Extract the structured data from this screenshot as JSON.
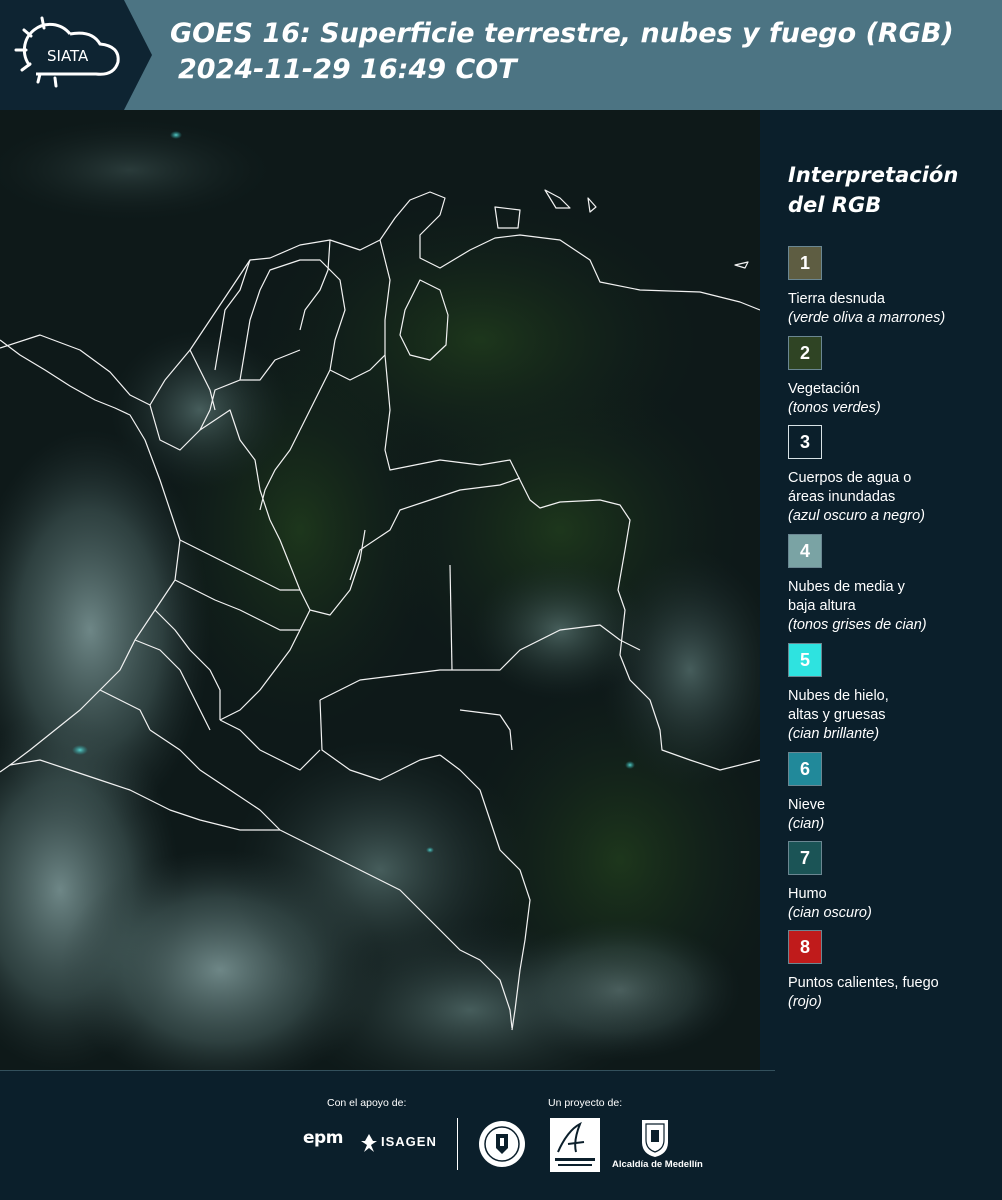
{
  "header": {
    "logo_text": "SIATA",
    "title_line1": "GOES 16: Superficie terrestre, nubes y fuego (RGB)",
    "title_line2": "2024-11-29 16:49 COT"
  },
  "legend": {
    "title": "Interpretación del RGB",
    "items": [
      {
        "number": "1",
        "name": "Tierra desnuda",
        "desc": "(verde oliva a marrones)",
        "color": "#5e5d42"
      },
      {
        "number": "2",
        "name": "Vegetación",
        "desc": "(tonos verdes)",
        "color": "#2f4424"
      },
      {
        "number": "3",
        "name": "Cuerpos de agua o\náreas inundadas",
        "desc": "(azul oscuro a negro)",
        "color": "#0b1f2b"
      },
      {
        "number": "4",
        "name": "Nubes de media y\nbaja altura",
        "desc": "(tonos grises de cian)",
        "color": "#7aa3a4"
      },
      {
        "number": "5",
        "name": "Nubes de hielo,\naltas y gruesas",
        "desc": "(cian brillante)",
        "color": "#2ee3e0"
      },
      {
        "number": "6",
        "name": "Nieve",
        "desc": "(cian)",
        "color": "#21899a"
      },
      {
        "number": "7",
        "name": "Humo",
        "desc": "(cian oscuro)",
        "color": "#1b5456"
      },
      {
        "number": "8",
        "name": "Puntos calientes, fuego",
        "desc": "(rojo)",
        "color": "#c01b1b"
      }
    ]
  },
  "footer": {
    "support_label": "Con el apoyo de:",
    "project_label": "Un proyecto de:",
    "epm": "epm",
    "isagen": "ISAGEN",
    "alcaldia": "Alcaldía de Medellín"
  }
}
